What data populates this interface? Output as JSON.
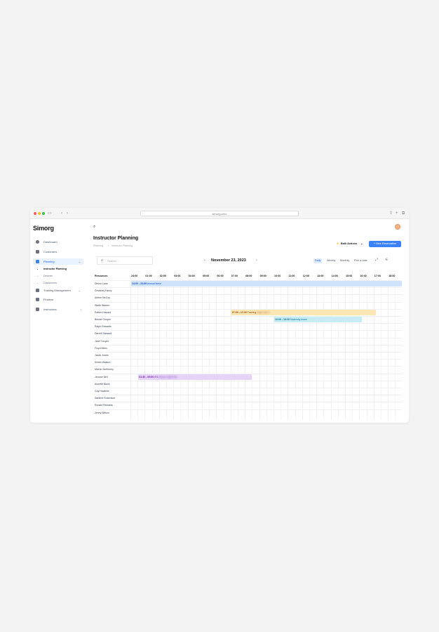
{
  "browser": {
    "url": "simorg.zero",
    "address_label": "simorg.zero"
  },
  "app": {
    "name": "Simorg"
  },
  "sidebar": {
    "items": [
      {
        "label": "Dashboard"
      },
      {
        "label": "Customers"
      },
      {
        "label": "Planning",
        "active": true
      },
      {
        "label": "Training Management"
      },
      {
        "label": "Finance"
      },
      {
        "label": "Instructors"
      }
    ],
    "planning_sub": [
      {
        "label": "Instructor Planning",
        "active": true
      },
      {
        "label": "Devices"
      },
      {
        "label": "Classrooms"
      }
    ]
  },
  "header": {
    "title": "Instructor Planning",
    "breadcrumb": [
      "Planning",
      "Instructor Planning"
    ],
    "bulk_actions": "Bulk Actions",
    "new_reservation": "New Reservation"
  },
  "toolbar": {
    "search_placeholder": "Search...",
    "date": "November 23, 2023",
    "views": [
      "Daily",
      "Weekly",
      "Monthly",
      "Pick a date"
    ],
    "active_view": "Daily"
  },
  "schedule": {
    "resources_header": "Resources",
    "hours": [
      "24:00",
      "01:00",
      "02:00",
      "03:00",
      "04:00",
      "05:00",
      "06:00",
      "07:00",
      "08:00",
      "09:00",
      "10:00",
      "11:00",
      "12:00",
      "13:00",
      "14:00",
      "15:00",
      "16:00",
      "17:00",
      "18:00"
    ],
    "resources": [
      "Devon Lane",
      "Courtney Henry",
      "Arlene McCoy",
      "Wade Warren",
      "Esther Howard",
      "Bessie Cooper",
      "Ralph Edwards",
      "Darrell Steward",
      "Jane Cooper",
      "Floyd Miles",
      "Jacob Jones",
      "Kristin Watson",
      "Marvin McKinney",
      "Jerome Bell",
      "Annette Black",
      "Guy Hawkins",
      "Darlene Robertson",
      "Ronald Richards",
      "Jenny Wilson"
    ],
    "events": [
      {
        "row": 0,
        "start": 0,
        "end": 19,
        "time": "24:00 - 23:59",
        "title": "Annual leave",
        "color": "#cfe3fb",
        "text_color": "#1d4ed8",
        "blurred": false
      },
      {
        "row": 4,
        "start": 7,
        "end": 17.2,
        "time": "07:00 - 17:30",
        "title": "Training",
        "extra": "Flight Sim 3",
        "color": "#fde7b4",
        "text_color": "#92400e",
        "blurred": false
      },
      {
        "row": 5,
        "start": 10,
        "end": 16.2,
        "time": "10:00 - 16:30",
        "title": "Maternity leave",
        "color": "#c6ecf5",
        "text_color": "#0e7490",
        "blurred": false
      },
      {
        "row": 13,
        "start": 0.5,
        "end": 8.5,
        "time": "01:30 - 09:00",
        "title": "IFA",
        "extra": "Nikola Flight Sim",
        "color": "#e5d3f8",
        "text_color": "#6b21a8",
        "blurred": false
      }
    ]
  },
  "colors": {
    "accent": "#3b82f6",
    "active_bg": "#e8f1fe"
  }
}
